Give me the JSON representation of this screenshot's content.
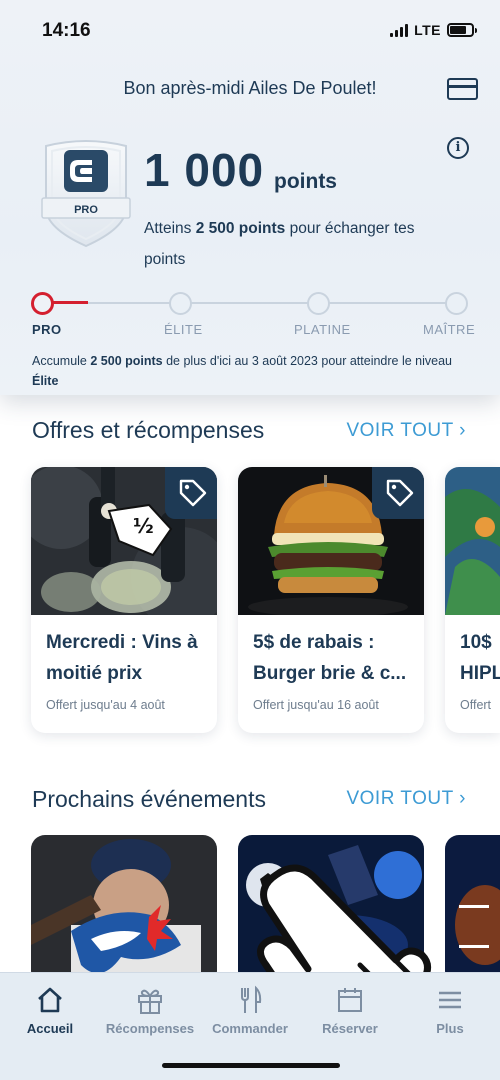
{
  "status": {
    "time": "14:16",
    "network": "LTE"
  },
  "header": {
    "greeting": "Bon après-midi Ailes De Poulet!",
    "badge_label": "PRO",
    "points_value": "1 000",
    "points_unit": "points",
    "exchange_prefix": "Atteins ",
    "exchange_bold": "2 500 points",
    "exchange_suffix": " pour échanger tes points"
  },
  "tiers": [
    {
      "label": "PRO",
      "active": true
    },
    {
      "label": "ÉLITE",
      "active": false
    },
    {
      "label": "PLATINE",
      "active": false
    },
    {
      "label": "MAÎTRE",
      "active": false
    }
  ],
  "progress": {
    "prefix": "Accumule ",
    "bold_points": "2 500 points",
    "middle": " de plus d'ici au 3 août 2023 pour atteindre le niveau ",
    "bold_tier": "Élite"
  },
  "offers_section": {
    "title": "Offres et récompenses",
    "see_all": "VOIR TOUT",
    "items": [
      {
        "title_line1": "Mercredi : Vins à",
        "title_line2": "moitié prix",
        "until": "Offert jusqu'au 4 août",
        "tag_icon": "tag-icon"
      },
      {
        "title_line1": "5$ de rabais :",
        "title_line2": "Burger brie & c...",
        "until": "Offert jusqu'au 16 août",
        "tag_icon": "tag-icon"
      },
      {
        "title_line1": "10$",
        "title_line2": "HIPL",
        "until": "Offert"
      }
    ]
  },
  "events_section": {
    "title": "Prochains événements",
    "see_all": "VOIR TOUT"
  },
  "tabbar": {
    "items": [
      {
        "label": "Accueil",
        "icon": "home-icon",
        "active": true
      },
      {
        "label": "Récompenses",
        "icon": "gift-icon",
        "active": false
      },
      {
        "label": "Commander",
        "icon": "utensils-icon",
        "active": false
      },
      {
        "label": "Réserver",
        "icon": "calendar-icon",
        "active": false
      },
      {
        "label": "Plus",
        "icon": "menu-icon",
        "active": false
      }
    ]
  },
  "colors": {
    "navy": "#1e3a55",
    "accent_blue": "#3d9bd4",
    "red": "#d41f2f",
    "tab_bg": "#e4ecf3"
  }
}
